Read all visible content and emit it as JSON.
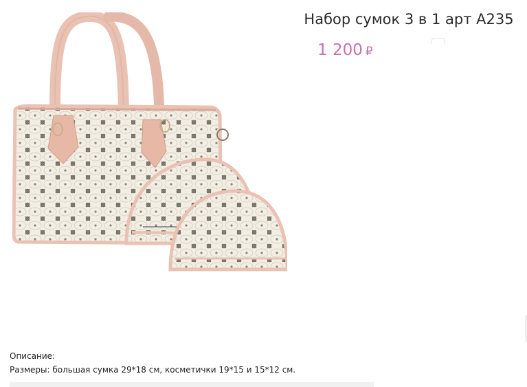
{
  "product": {
    "title": "Набор сумок 3 в 1 арт A235",
    "price": "1 200",
    "currency": "₽",
    "image_alt": "bag-set-image"
  },
  "description": {
    "label": "Описание:",
    "text": "Размеры: большая сумка 29*18 см, косметички 19*15 и 15*12 см."
  },
  "colors": {
    "price": "#c96fae",
    "bag_canvas": "#f3eee4",
    "bag_trim": "#e9c2b3",
    "pattern": "#8a8478"
  }
}
